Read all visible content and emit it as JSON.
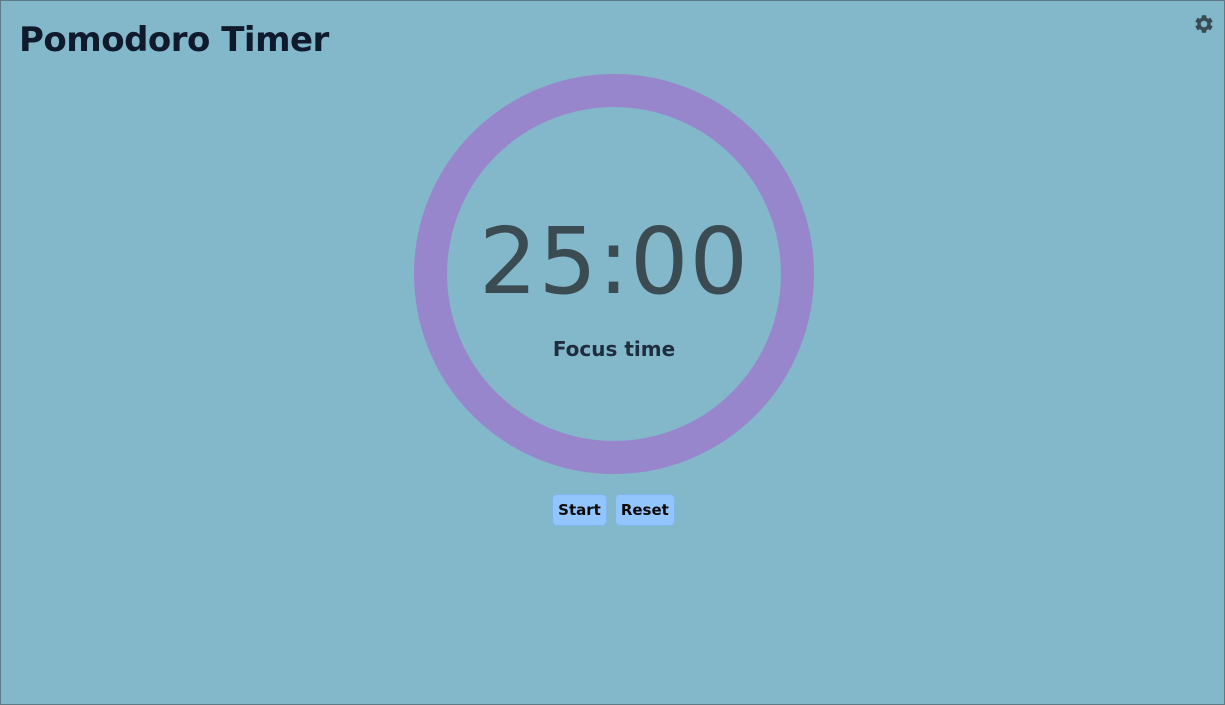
{
  "header": {
    "title": "Pomodoro Timer",
    "settings_icon": "gear-icon"
  },
  "timer": {
    "time": "25:00",
    "mode": "Focus time",
    "progress": 1.0,
    "ring_color": "#9886cc"
  },
  "controls": {
    "start_label": "Start",
    "reset_label": "Reset"
  },
  "colors": {
    "background": "#83b7ca",
    "button": "#93c5fd",
    "title_text": "#0f1b2d",
    "time_text": "#3b4b52"
  }
}
